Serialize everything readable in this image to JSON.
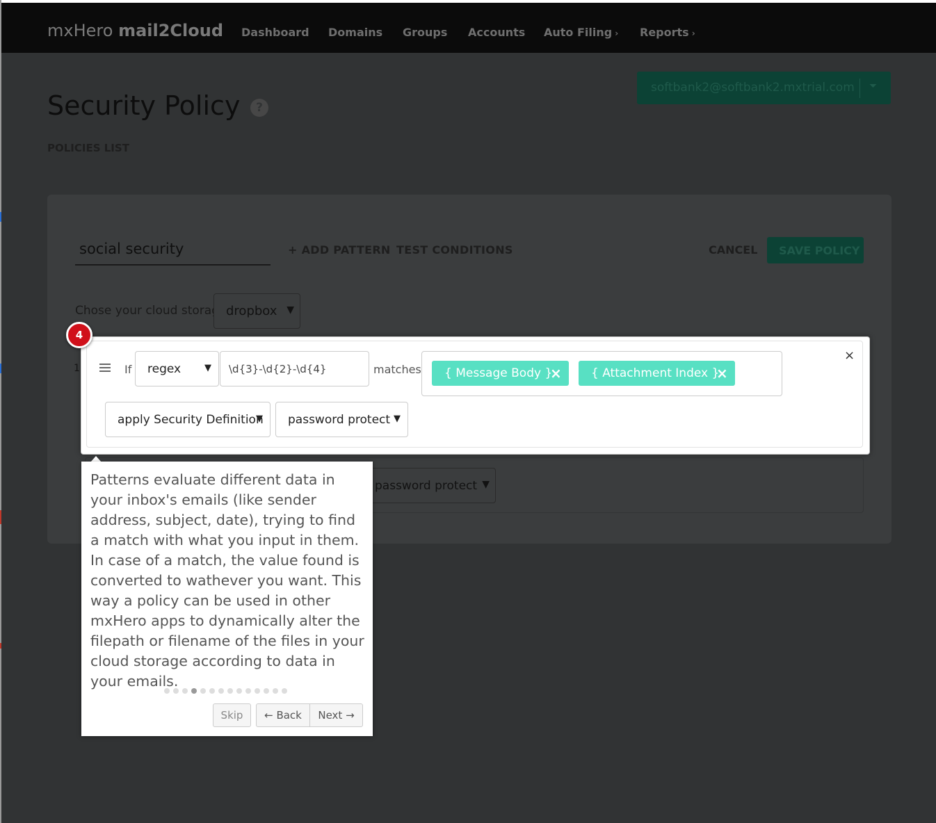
{
  "nav": {
    "brand_light": "mxHero",
    "brand_bold": "mail2Cloud",
    "items": [
      {
        "label": "Dashboard"
      },
      {
        "label": "Domains"
      },
      {
        "label": "Groups"
      },
      {
        "label": "Accounts"
      },
      {
        "label": "Auto Filing",
        "chevron": "›"
      },
      {
        "label": "Reports",
        "chevron": "›"
      }
    ]
  },
  "page": {
    "title": "Security Policy",
    "help_icon": "?",
    "policies_link": "POLICIES LIST",
    "account": "softbank2@softbank2.mxtrial.com",
    "account_caret": "⏷"
  },
  "policy": {
    "name": "social security",
    "add_pattern": "+ ADD PATTERN",
    "test_conditions": "TEST CONDITIONS",
    "cancel": "CANCEL",
    "save": "SAVE POLICY",
    "storage_label": "Chose your cloud storage",
    "storage_value": "dropbox",
    "row_number": "1",
    "ghost_action": "password protect"
  },
  "pattern": {
    "if_label": "If",
    "type": "regex",
    "regex_value": "\\d{3}-\\d{2}-\\d{4}",
    "matches_label": "matches",
    "tags": [
      {
        "label": "{ Message Body }",
        "remove": "×"
      },
      {
        "label": "{ Attachment Index }",
        "remove": "×"
      }
    ],
    "action": "apply Security Definition",
    "action_value": "password protect",
    "close": "×"
  },
  "tour": {
    "step": "4",
    "text": "Patterns evaluate different data in your inbox's emails (like sender address, subject, date), trying to find a match with what you input in them. In case of a match, the value found is converted to wathever you want. This way a policy can be used in other mxHero apps to dynamically alter the filepath or filename of the files in your cloud storage according to data in your emails.",
    "total_steps": 14,
    "current_step": 4,
    "skip": "Skip",
    "back": "← Back",
    "next": "Next →"
  },
  "colors": {
    "accent": "#58e0c3",
    "badge": "#d0101a",
    "navbar": "#0b0b0b",
    "overlay": "#313334"
  }
}
